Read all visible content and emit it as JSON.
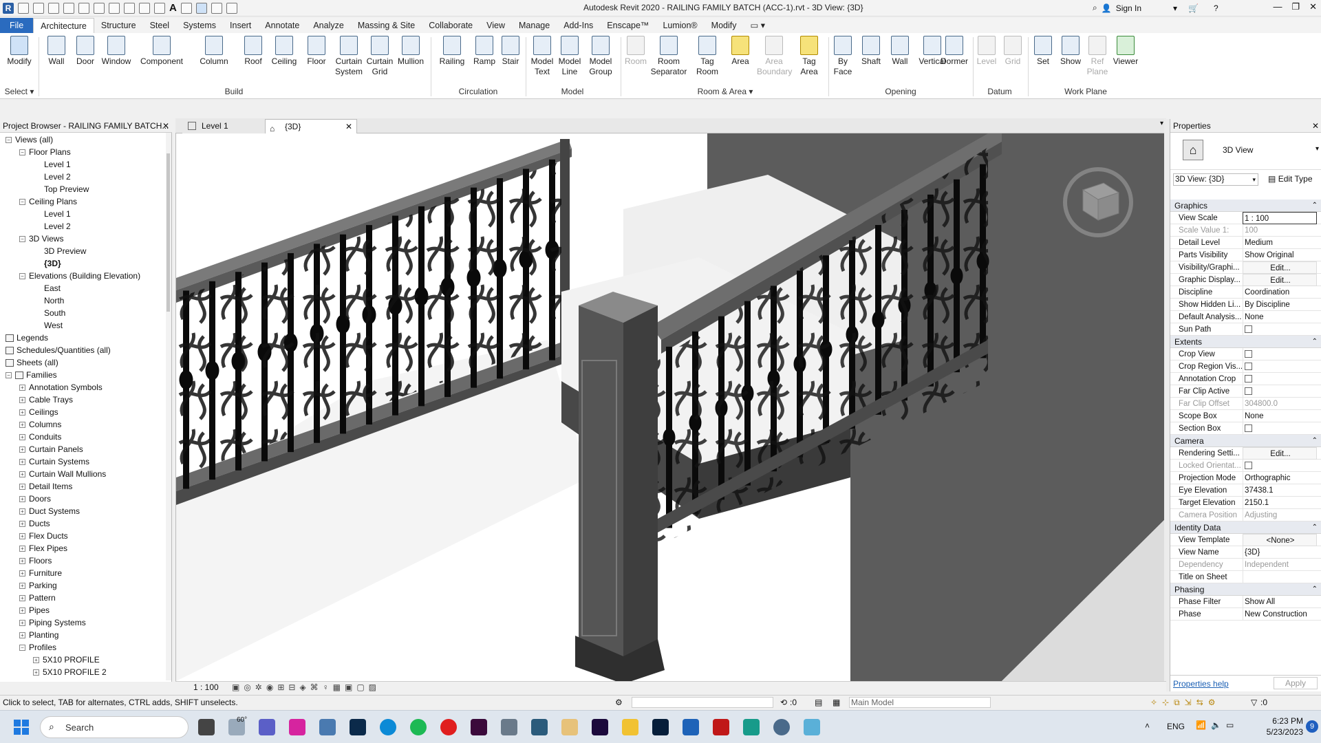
{
  "titlebar": {
    "title": "Autodesk Revit 2020 - RAILING FAMILY BATCH (ACC-1).rvt - 3D View: {3D}",
    "sign_in": "Sign In"
  },
  "menu": {
    "file": "File",
    "tabs": [
      "Architecture",
      "Structure",
      "Steel",
      "Systems",
      "Insert",
      "Annotate",
      "Analyze",
      "Massing & Site",
      "Collaborate",
      "View",
      "Manage",
      "Add-Ins",
      "Enscape™",
      "Lumion®",
      "Modify"
    ]
  },
  "ribbon": {
    "modify": "Modify",
    "select": "Select",
    "build": {
      "label": "Build",
      "wall": "Wall",
      "door": "Door",
      "window": "Window",
      "component": "Component",
      "column": "Column",
      "roof": "Roof",
      "ceiling": "Ceiling",
      "floor": "Floor",
      "curtain_system": "Curtain System",
      "curtain_grid": "Curtain Grid",
      "mullion": "Mullion"
    },
    "circulation": {
      "label": "Circulation",
      "railing": "Railing",
      "ramp": "Ramp",
      "stair": "Stair"
    },
    "model": {
      "label": "Model",
      "model_text": "Model Text",
      "model_line": "Model Line",
      "model_group": "Model Group"
    },
    "room_area": {
      "label": "Room & Area",
      "room": "Room",
      "room_separator": "Room Separator",
      "tag_room": "Tag Room",
      "area": "Area",
      "area_boundary": "Area Boundary",
      "tag_area": "Tag Area"
    },
    "opening": {
      "label": "Opening",
      "by_face": "By Face",
      "shaft": "Shaft",
      "wall": "Wall",
      "vertical": "Vertical",
      "dormer": "Dormer"
    },
    "datum": {
      "label": "Datum",
      "level": "Level",
      "grid": "Grid"
    },
    "work_plane": {
      "label": "Work Plane",
      "set": "Set",
      "show": "Show",
      "ref_plane": "Ref Plane",
      "viewer": "Viewer"
    }
  },
  "project_browser": {
    "title": "Project Browser - RAILING FAMILY BATCH...",
    "tree": [
      {
        "label": "Views (all)",
        "indent": 0,
        "toggle": "-"
      },
      {
        "label": "Floor Plans",
        "indent": 1,
        "toggle": "-"
      },
      {
        "label": "Level 1",
        "indent": 2,
        "toggle": ""
      },
      {
        "label": "Level 2",
        "indent": 2,
        "toggle": ""
      },
      {
        "label": "Top Preview",
        "indent": 2,
        "toggle": ""
      },
      {
        "label": "Ceiling Plans",
        "indent": 1,
        "toggle": "-"
      },
      {
        "label": "Level 1",
        "indent": 2,
        "toggle": ""
      },
      {
        "label": "Level 2",
        "indent": 2,
        "toggle": ""
      },
      {
        "label": "3D Views",
        "indent": 1,
        "toggle": "-"
      },
      {
        "label": "3D Preview",
        "indent": 2,
        "toggle": ""
      },
      {
        "label": "{3D}",
        "indent": 2,
        "toggle": "",
        "bold": true
      },
      {
        "label": "Elevations (Building Elevation)",
        "indent": 1,
        "toggle": "-"
      },
      {
        "label": "East",
        "indent": 2,
        "toggle": ""
      },
      {
        "label": "North",
        "indent": 2,
        "toggle": ""
      },
      {
        "label": "South",
        "indent": 2,
        "toggle": ""
      },
      {
        "label": "West",
        "indent": 2,
        "toggle": ""
      },
      {
        "label": "Legends",
        "indent": 0,
        "toggle": "",
        "icon": true
      },
      {
        "label": "Schedules/Quantities (all)",
        "indent": 0,
        "toggle": "",
        "icon": true
      },
      {
        "label": "Sheets (all)",
        "indent": 0,
        "toggle": "",
        "icon": true
      },
      {
        "label": "Families",
        "indent": 0,
        "toggle": "-",
        "icon": true
      },
      {
        "label": "Annotation Symbols",
        "indent": 1,
        "toggle": "+"
      },
      {
        "label": "Cable Trays",
        "indent": 1,
        "toggle": "+"
      },
      {
        "label": "Ceilings",
        "indent": 1,
        "toggle": "+"
      },
      {
        "label": "Columns",
        "indent": 1,
        "toggle": "+"
      },
      {
        "label": "Conduits",
        "indent": 1,
        "toggle": "+"
      },
      {
        "label": "Curtain Panels",
        "indent": 1,
        "toggle": "+"
      },
      {
        "label": "Curtain Systems",
        "indent": 1,
        "toggle": "+"
      },
      {
        "label": "Curtain Wall Mullions",
        "indent": 1,
        "toggle": "+"
      },
      {
        "label": "Detail Items",
        "indent": 1,
        "toggle": "+"
      },
      {
        "label": "Doors",
        "indent": 1,
        "toggle": "+"
      },
      {
        "label": "Duct Systems",
        "indent": 1,
        "toggle": "+"
      },
      {
        "label": "Ducts",
        "indent": 1,
        "toggle": "+"
      },
      {
        "label": "Flex Ducts",
        "indent": 1,
        "toggle": "+"
      },
      {
        "label": "Flex Pipes",
        "indent": 1,
        "toggle": "+"
      },
      {
        "label": "Floors",
        "indent": 1,
        "toggle": "+"
      },
      {
        "label": "Furniture",
        "indent": 1,
        "toggle": "+"
      },
      {
        "label": "Parking",
        "indent": 1,
        "toggle": "+"
      },
      {
        "label": "Pattern",
        "indent": 1,
        "toggle": "+"
      },
      {
        "label": "Pipes",
        "indent": 1,
        "toggle": "+"
      },
      {
        "label": "Piping Systems",
        "indent": 1,
        "toggle": "+"
      },
      {
        "label": "Planting",
        "indent": 1,
        "toggle": "+"
      },
      {
        "label": "Profiles",
        "indent": 1,
        "toggle": "-"
      },
      {
        "label": "5X10 PROFILE",
        "indent": 2,
        "toggle": "+"
      },
      {
        "label": "5X10 PROFILE 2",
        "indent": 2,
        "toggle": "+"
      }
    ]
  },
  "view_tabs": [
    {
      "label": "Level 1",
      "active": false
    },
    {
      "label": "{3D}",
      "active": true
    }
  ],
  "properties": {
    "title": "Properties",
    "type_name": "3D View",
    "selector": "3D View: {3D}",
    "edit_type": "Edit Type",
    "help_link": "Properties help",
    "apply": "Apply",
    "sections": [
      {
        "name": "Graphics",
        "rows": [
          {
            "k": "View Scale",
            "v": "1 : 100"
          },
          {
            "k": "Scale Value    1:",
            "v": "100",
            "dim": true
          },
          {
            "k": "Detail Level",
            "v": "Medium"
          },
          {
            "k": "Parts Visibility",
            "v": "Show Original"
          },
          {
            "k": "Visibility/Graphi...",
            "v": "Edit...",
            "btn": true
          },
          {
            "k": "Graphic Display...",
            "v": "Edit...",
            "btn": true
          },
          {
            "k": "Discipline",
            "v": "Coordination"
          },
          {
            "k": "Show Hidden Li...",
            "v": "By Discipline"
          },
          {
            "k": "Default Analysis...",
            "v": "None"
          },
          {
            "k": "Sun Path",
            "v": "",
            "cb": true
          }
        ]
      },
      {
        "name": "Extents",
        "rows": [
          {
            "k": "Crop View",
            "v": "",
            "cb": true
          },
          {
            "k": "Crop Region Vis...",
            "v": "",
            "cb": true
          },
          {
            "k": "Annotation Crop",
            "v": "",
            "cb": true
          },
          {
            "k": "Far Clip Active",
            "v": "",
            "cb": true
          },
          {
            "k": "Far Clip Offset",
            "v": "304800.0",
            "dim": true
          },
          {
            "k": "Scope Box",
            "v": "None"
          },
          {
            "k": "Section Box",
            "v": "",
            "cb": true
          }
        ]
      },
      {
        "name": "Camera",
        "rows": [
          {
            "k": "Rendering Setti...",
            "v": "Edit...",
            "btn": true
          },
          {
            "k": "Locked Orientat...",
            "v": "",
            "cb": true,
            "dim": true
          },
          {
            "k": "Projection Mode",
            "v": "Orthographic"
          },
          {
            "k": "Eye Elevation",
            "v": "37438.1"
          },
          {
            "k": "Target Elevation",
            "v": "2150.1"
          },
          {
            "k": "Camera Position",
            "v": "Adjusting",
            "dim": true
          }
        ]
      },
      {
        "name": "Identity Data",
        "rows": [
          {
            "k": "View Template",
            "v": "<None>",
            "btn": true
          },
          {
            "k": "View Name",
            "v": "{3D}"
          },
          {
            "k": "Dependency",
            "v": "Independent",
            "dim": true
          },
          {
            "k": "Title on Sheet",
            "v": ""
          }
        ]
      },
      {
        "name": "Phasing",
        "rows": [
          {
            "k": "Phase Filter",
            "v": "Show All"
          },
          {
            "k": "Phase",
            "v": "New Construction"
          }
        ]
      }
    ]
  },
  "view_control": {
    "scale": "1 : 100"
  },
  "status": {
    "hint": "Click to select, TAB for alternates, CTRL adds, SHIFT unselects.",
    "workset_count": ":0",
    "main_model": "Main Model",
    "filter_count": ":0"
  },
  "taskbar": {
    "search": "Search",
    "weather": "60°",
    "lang": "ENG",
    "time": "6:23 PM",
    "date": "5/23/2023",
    "notifications": "9"
  }
}
